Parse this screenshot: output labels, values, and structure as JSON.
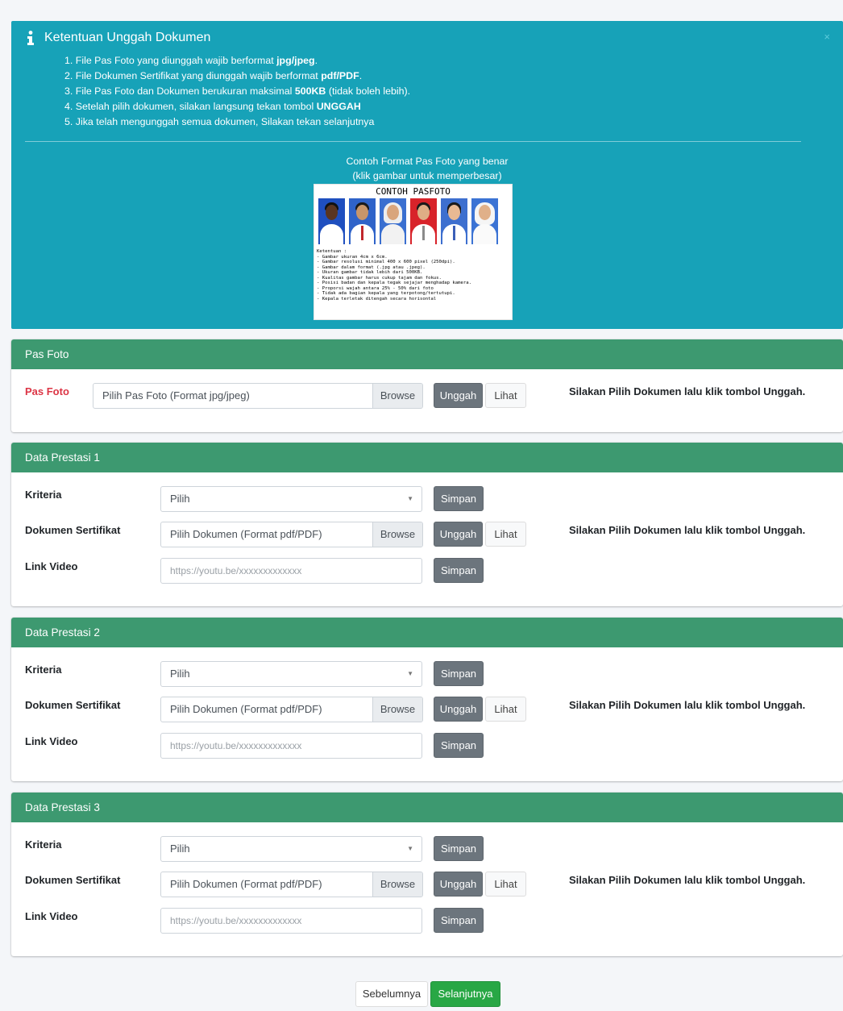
{
  "info": {
    "title": "Ketentuan Unggah Dokumen",
    "close": "×",
    "rules": [
      {
        "pre": "1. File Pas Foto yang diunggah wajib berformat ",
        "bold": "jpg/jpeg",
        "post": "."
      },
      {
        "pre": "2. File Dokumen Sertifikat yang diunggah wajib berformat ",
        "bold": "pdf/PDF",
        "post": "."
      },
      {
        "pre": "3. File Pas Foto dan Dokumen berukuran maksimal ",
        "bold": "500KB",
        "post": " (tidak boleh lebih)."
      },
      {
        "pre": "4. Setelah pilih dokumen, silakan langsung tekan tombol ",
        "bold": "UNGGAH",
        "post": ""
      },
      {
        "pre": "5. Jika telah mengunggah semua dokumen, Silakan tekan selanjutnya",
        "bold": "",
        "post": ""
      }
    ],
    "sample_caption_1": "Contoh Format Pas Foto yang benar",
    "sample_caption_2": "(klik gambar untuk memperbesar)",
    "sample_title": "CONTOH PASFOTO",
    "sample_rules": "Ketentuan :\n- Gambar ukuran 4cm x 6cm.\n- Gambar resolusi minimal 400 x 600 pixel (250dpi).\n- Gambar dalam format (.jpg atau .jpeg).\n- Ukuran gambar tidak lebih dari 500KB.\n- Kualitas gambar harus cukup tajam dan fokus.\n- Posisi badan dan kepala tegak sejajar menghadap kamera.\n- Proporsi wajah antara 25% - 50% dari foto\n- Tidak ada bagian kepala yang terpotong/tertutupi.\n- Kepala terletak ditengah secara horisontal",
    "photo_backgrounds": [
      "#1f4fbf",
      "#2f63c9",
      "#3a6fd0",
      "#d8232a",
      "#3d6fcf",
      "#3b73d4"
    ]
  },
  "pasfoto": {
    "header": "Pas Foto",
    "label": "Pas Foto",
    "file_placeholder": "Pilih Pas Foto (Format jpg/jpeg)",
    "browse": "Browse",
    "upload": "Unggah",
    "view": "Lihat",
    "status": "Silakan Pilih Dokumen lalu klik tombol Unggah."
  },
  "prestasi": [
    {
      "header": "Data Prestasi 1",
      "kriteria_label": "Kriteria",
      "kriteria_value": "Pilih",
      "save": "Simpan",
      "dokumen_label": "Dokumen Sertifikat",
      "file_placeholder": "Pilih Dokumen (Format pdf/PDF)",
      "browse": "Browse",
      "upload": "Unggah",
      "view": "Lihat",
      "status": "Silakan Pilih Dokumen lalu klik tombol Unggah.",
      "video_label": "Link Video",
      "video_placeholder": "https://youtu.be/xxxxxxxxxxxxx",
      "video_save": "Simpan"
    },
    {
      "header": "Data Prestasi 2",
      "kriteria_label": "Kriteria",
      "kriteria_value": "Pilih",
      "save": "Simpan",
      "dokumen_label": "Dokumen Sertifikat",
      "file_placeholder": "Pilih Dokumen (Format pdf/PDF)",
      "browse": "Browse",
      "upload": "Unggah",
      "view": "Lihat",
      "status": "Silakan Pilih Dokumen lalu klik tombol Unggah.",
      "video_label": "Link Video",
      "video_placeholder": "https://youtu.be/xxxxxxxxxxxxx",
      "video_save": "Simpan"
    },
    {
      "header": "Data Prestasi 3",
      "kriteria_label": "Kriteria",
      "kriteria_value": "Pilih",
      "save": "Simpan",
      "dokumen_label": "Dokumen Sertifikat",
      "file_placeholder": "Pilih Dokumen (Format pdf/PDF)",
      "browse": "Browse",
      "upload": "Unggah",
      "view": "Lihat",
      "status": "Silakan Pilih Dokumen lalu klik tombol Unggah.",
      "video_label": "Link Video",
      "video_placeholder": "https://youtu.be/xxxxxxxxxxxxx",
      "video_save": "Simpan"
    }
  ],
  "nav": {
    "prev": "Sebelumnya",
    "next": "Selanjutnya"
  },
  "colors": {
    "info": "#17a2b8",
    "card_header": "#3d9970",
    "required_label": "#dc3545",
    "next_button": "#28a745",
    "button_gray": "#6c757d"
  }
}
